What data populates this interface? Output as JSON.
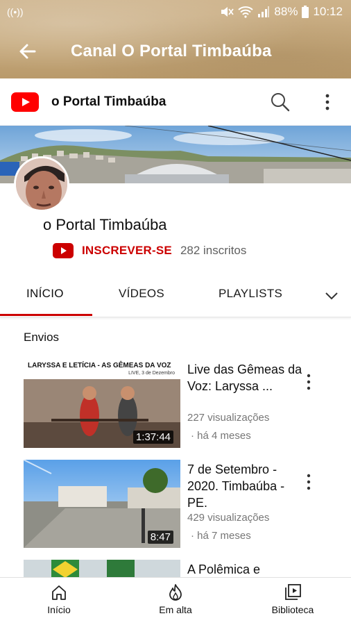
{
  "status_bar": {
    "battery": "88%",
    "time": "10:12"
  },
  "app_bar": {
    "title": "Canal O Portal Timbaúba"
  },
  "yt_header": {
    "title": "o Portal Timbaúba"
  },
  "channel": {
    "name": "o Portal Timbaúba",
    "subscribe_label": "INSCREVER-SE",
    "subscriber_count": "282 inscritos"
  },
  "tabs": [
    {
      "label": "INÍCIO",
      "selected": true
    },
    {
      "label": "VÍDEOS",
      "selected": false
    },
    {
      "label": "PLAYLISTS",
      "selected": false
    }
  ],
  "section": {
    "title": "Envios"
  },
  "videos": [
    {
      "thumb_caption": "LARYSSA E LETÍCIA - AS GÊMEAS DA VOZ",
      "thumb_subcaption": "LIVE, 3 de Dezembro",
      "title": "Live das Gêmeas da Voz: Laryssa ...",
      "views": "227 visualizações",
      "age": "· há 4 meses",
      "duration": "1:37:44"
    },
    {
      "title": "7 de Setembro - 2020. Timbaúba - PE.",
      "views": "429 visualizações",
      "age": "· há 7 meses",
      "duration": "8:47"
    },
    {
      "title": "A Polêmica e"
    }
  ],
  "bottom_nav": [
    {
      "label": "Início",
      "icon": "home-icon"
    },
    {
      "label": "Em alta",
      "icon": "flame-icon"
    },
    {
      "label": "Biblioteca",
      "icon": "library-icon"
    }
  ],
  "colors": {
    "youtube_red": "#cc0000",
    "app_bar_parchment": "#c6a97c"
  }
}
